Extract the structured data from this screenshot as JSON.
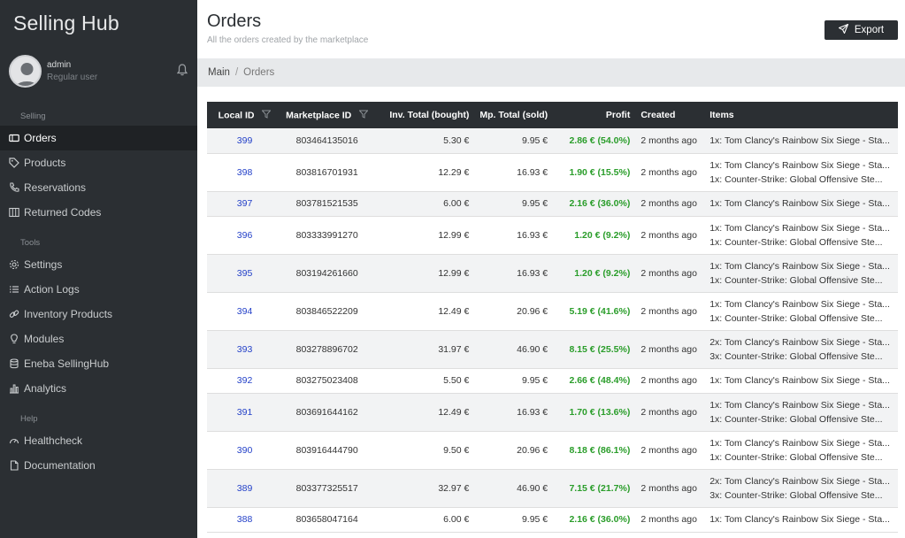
{
  "app": {
    "title": "Selling Hub"
  },
  "user": {
    "name": "admin",
    "role": "Regular user"
  },
  "sidebar": {
    "sections": [
      {
        "label": "Selling",
        "items": [
          {
            "label": "Orders",
            "icon": "ticket-icon",
            "active": true
          },
          {
            "label": "Products",
            "icon": "tag-icon"
          },
          {
            "label": "Reservations",
            "icon": "phone-icon"
          },
          {
            "label": "Returned Codes",
            "icon": "columns-icon"
          }
        ]
      },
      {
        "label": "Tools",
        "items": [
          {
            "label": "Settings",
            "icon": "gear-icon"
          },
          {
            "label": "Action Logs",
            "icon": "list-icon"
          },
          {
            "label": "Inventory Products",
            "icon": "link-icon"
          },
          {
            "label": "Modules",
            "icon": "lightbulb-icon"
          },
          {
            "label": "Eneba SellingHub",
            "icon": "database-icon"
          },
          {
            "label": "Analytics",
            "icon": "bar-chart-icon"
          }
        ]
      },
      {
        "label": "Help",
        "items": [
          {
            "label": "Healthcheck",
            "icon": "gauge-icon"
          },
          {
            "label": "Documentation",
            "icon": "document-icon"
          }
        ]
      }
    ]
  },
  "header": {
    "title": "Orders",
    "subtitle": "All the orders created by the marketplace",
    "export_label": "Export"
  },
  "breadcrumb": {
    "main": "Main",
    "separator": "/",
    "current": "Orders"
  },
  "table": {
    "columns": {
      "local_id": "Local ID",
      "marketplace_id": "Marketplace ID",
      "inv_total": "Inv. Total (bought)",
      "mp_total": "Mp. Total (sold)",
      "profit": "Profit",
      "created": "Created",
      "items": "Items"
    },
    "rows": [
      {
        "local_id": "399",
        "mp_id": "803464135016",
        "inv": "5.30 €",
        "mp": "9.95 €",
        "profit": "2.86 € (54.0%)",
        "created": "2 months ago",
        "items": [
          "1x: Tom Clancy's Rainbow Six Siege - Sta..."
        ]
      },
      {
        "local_id": "398",
        "mp_id": "803816701931",
        "inv": "12.29 €",
        "mp": "16.93 €",
        "profit": "1.90 € (15.5%)",
        "created": "2 months ago",
        "items": [
          "1x: Tom Clancy's Rainbow Six Siege - Sta...",
          "1x: Counter-Strike: Global Offensive Ste..."
        ]
      },
      {
        "local_id": "397",
        "mp_id": "803781521535",
        "inv": "6.00 €",
        "mp": "9.95 €",
        "profit": "2.16 € (36.0%)",
        "created": "2 months ago",
        "items": [
          "1x: Tom Clancy's Rainbow Six Siege - Sta..."
        ]
      },
      {
        "local_id": "396",
        "mp_id": "803333991270",
        "inv": "12.99 €",
        "mp": "16.93 €",
        "profit": "1.20 € (9.2%)",
        "created": "2 months ago",
        "items": [
          "1x: Tom Clancy's Rainbow Six Siege - Sta...",
          "1x: Counter-Strike: Global Offensive Ste..."
        ]
      },
      {
        "local_id": "395",
        "mp_id": "803194261660",
        "inv": "12.99 €",
        "mp": "16.93 €",
        "profit": "1.20 € (9.2%)",
        "created": "2 months ago",
        "items": [
          "1x: Tom Clancy's Rainbow Six Siege - Sta...",
          "1x: Counter-Strike: Global Offensive Ste..."
        ]
      },
      {
        "local_id": "394",
        "mp_id": "803846522209",
        "inv": "12.49 €",
        "mp": "20.96 €",
        "profit": "5.19 € (41.6%)",
        "created": "2 months ago",
        "items": [
          "1x: Tom Clancy's Rainbow Six Siege - Sta...",
          "1x: Counter-Strike: Global Offensive Ste..."
        ]
      },
      {
        "local_id": "393",
        "mp_id": "803278896702",
        "inv": "31.97 €",
        "mp": "46.90 €",
        "profit": "8.15 € (25.5%)",
        "created": "2 months ago",
        "items": [
          "2x: Tom Clancy's Rainbow Six Siege - Sta...",
          "3x: Counter-Strike: Global Offensive Ste..."
        ]
      },
      {
        "local_id": "392",
        "mp_id": "803275023408",
        "inv": "5.50 €",
        "mp": "9.95 €",
        "profit": "2.66 € (48.4%)",
        "created": "2 months ago",
        "items": [
          "1x: Tom Clancy's Rainbow Six Siege - Sta..."
        ]
      },
      {
        "local_id": "391",
        "mp_id": "803691644162",
        "inv": "12.49 €",
        "mp": "16.93 €",
        "profit": "1.70 € (13.6%)",
        "created": "2 months ago",
        "items": [
          "1x: Tom Clancy's Rainbow Six Siege - Sta...",
          "1x: Counter-Strike: Global Offensive Ste..."
        ]
      },
      {
        "local_id": "390",
        "mp_id": "803916444790",
        "inv": "9.50 €",
        "mp": "20.96 €",
        "profit": "8.18 € (86.1%)",
        "created": "2 months ago",
        "items": [
          "1x: Tom Clancy's Rainbow Six Siege - Sta...",
          "1x: Counter-Strike: Global Offensive Ste..."
        ]
      },
      {
        "local_id": "389",
        "mp_id": "803377325517",
        "inv": "32.97 €",
        "mp": "46.90 €",
        "profit": "7.15 € (21.7%)",
        "created": "2 months ago",
        "items": [
          "2x: Tom Clancy's Rainbow Six Siege - Sta...",
          "3x: Counter-Strike: Global Offensive Ste..."
        ]
      },
      {
        "local_id": "388",
        "mp_id": "803658047164",
        "inv": "6.00 €",
        "mp": "9.95 €",
        "profit": "2.16 € (36.0%)",
        "created": "2 months ago",
        "items": [
          "1x: Tom Clancy's Rainbow Six Siege - Sta..."
        ]
      }
    ]
  },
  "colors": {
    "sidebar_bg": "#2b2f33",
    "active_item_bg": "#1f2225",
    "profit_green": "#2a9d2a",
    "link_blue": "#2340c8"
  }
}
